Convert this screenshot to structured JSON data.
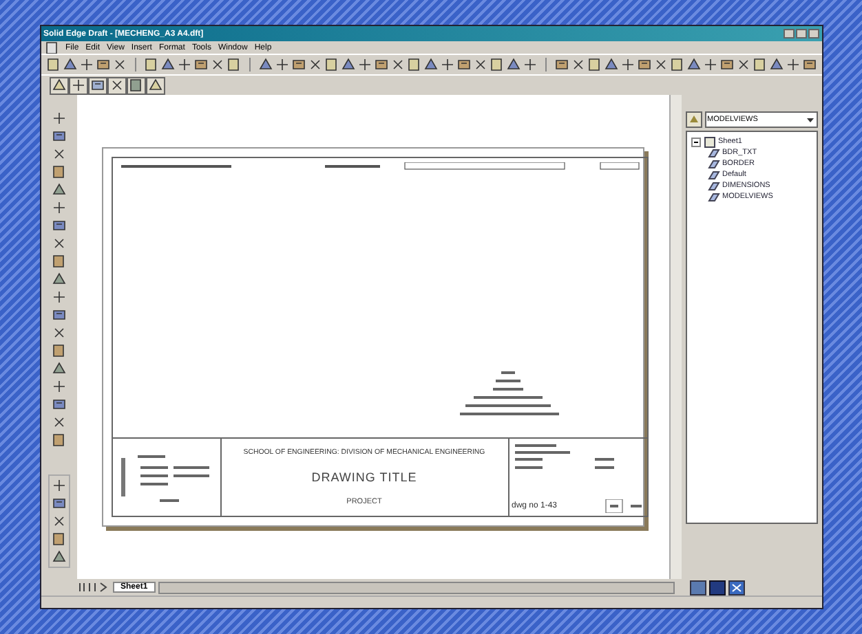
{
  "window": {
    "title": "Solid Edge Draft - [MECHENG_A3 A4.dft]"
  },
  "menu": [
    "File",
    "Edit",
    "View",
    "Insert",
    "Format",
    "Tools",
    "Window",
    "Help"
  ],
  "sheet": {
    "school": "SCHOOL OF ENGINEERING: DIVISION OF MECHANICAL ENGINEERING",
    "title": "DRAWING TITLE",
    "project": "PROJECT",
    "drawing_number": "dwg no 1-43"
  },
  "library": {
    "combo": "MODELVIEWS",
    "tree": [
      {
        "label": "Sheet1",
        "expanded": true,
        "children": [
          {
            "label": "BDR_TXT"
          },
          {
            "label": "BORDER"
          },
          {
            "label": "Default"
          },
          {
            "label": "DIMENSIONS"
          },
          {
            "label": "MODELVIEWS"
          }
        ]
      }
    ]
  },
  "tabs": [
    {
      "label": "Sheet1",
      "selected": true
    }
  ]
}
